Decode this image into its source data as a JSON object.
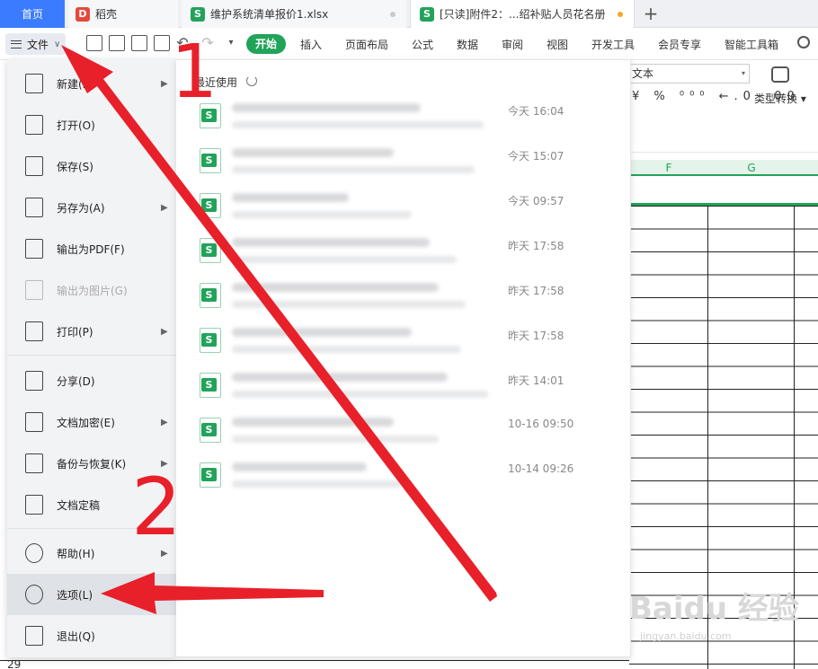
{
  "tabs": [
    {
      "label": "首页"
    },
    {
      "label": "稻壳"
    },
    {
      "label": "维护系统清单报价1.xlsx"
    },
    {
      "label": "[只读]附件2：...绍补贴人员花名册"
    }
  ],
  "ribbon": {
    "file_label": "文件",
    "tabs": [
      "开始",
      "插入",
      "页面布局",
      "公式",
      "数据",
      "审阅",
      "视图",
      "开发工具",
      "会员专享",
      "智能工具箱"
    ]
  },
  "format_panel": {
    "number_format": "文本",
    "icons": "¥ % ⁰⁰⁰ ←.0 .00",
    "type_convert": "类型转换"
  },
  "sheet": {
    "columns": [
      "F",
      "G"
    ],
    "visible_row_number": "29"
  },
  "file_menu": {
    "items": [
      {
        "label": "新建(N)",
        "has_submenu": true,
        "icon": "new-file-icon"
      },
      {
        "label": "打开(O)",
        "has_submenu": false,
        "icon": "folder-open-icon"
      },
      {
        "label": "保存(S)",
        "has_submenu": false,
        "icon": "save-icon"
      },
      {
        "label": "另存为(A)",
        "has_submenu": true,
        "icon": "save-as-icon"
      },
      {
        "label": "输出为PDF(F)",
        "has_submenu": false,
        "icon": "pdf-icon"
      },
      {
        "label": "输出为图片(G)",
        "has_submenu": false,
        "disabled": true,
        "icon": "image-icon"
      },
      {
        "label": "打印(P)",
        "has_submenu": true,
        "icon": "print-icon"
      },
      {
        "label": "分享(D)",
        "has_submenu": false,
        "icon": "share-icon"
      },
      {
        "label": "文档加密(E)",
        "has_submenu": true,
        "icon": "encrypt-icon"
      },
      {
        "label": "备份与恢复(K)",
        "has_submenu": true,
        "icon": "backup-icon"
      },
      {
        "label": "文档定稿",
        "has_submenu": false,
        "icon": "finalize-icon"
      },
      {
        "label": "帮助(H)",
        "has_submenu": true,
        "icon": "help-icon"
      },
      {
        "label": "选项(L)",
        "has_submenu": false,
        "active": true,
        "icon": "gear-icon"
      },
      {
        "label": "退出(Q)",
        "has_submenu": false,
        "icon": "exit-icon"
      }
    ]
  },
  "recent": {
    "title": "最近使用",
    "files": [
      {
        "time": "今天  16:04"
      },
      {
        "time": "今天  15:07"
      },
      {
        "time": "今天  09:57"
      },
      {
        "time": "昨天  17:58"
      },
      {
        "time": "昨天  17:58"
      },
      {
        "time": "昨天  17:58"
      },
      {
        "time": "昨天  14:01"
      },
      {
        "time": "10-16  09:50"
      },
      {
        "time": "10-14  09:26"
      }
    ]
  },
  "annotations": {
    "step1": "1",
    "step2": "2",
    "color": "#e8202a"
  },
  "watermark": {
    "brand": "Baidu 经验",
    "url": "jingyan.baidu.com"
  }
}
